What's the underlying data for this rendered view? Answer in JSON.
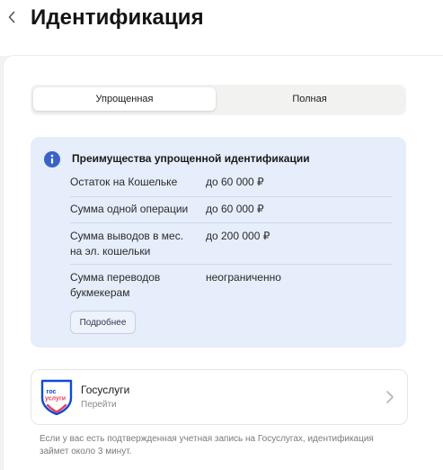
{
  "header": {
    "title": "Идентификация",
    "back_icon": "chevron-left-icon"
  },
  "tabs": [
    {
      "label": "Упрощенная",
      "active": true
    },
    {
      "label": "Полная",
      "active": false
    }
  ],
  "info": {
    "icon": "info-icon",
    "accent_color": "#3a63c6",
    "heading": "Преимущества упрощенной идентификации",
    "rows": [
      {
        "label": "Остаток на Кошельке",
        "value": "до 60 000 ₽"
      },
      {
        "label": "Сумма одной операции",
        "value": "до 60 000 ₽"
      },
      {
        "label": "Сумма выводов в мес. на эл. кошельки",
        "value": "до 200 000 ₽"
      },
      {
        "label": "Сумма переводов букмекерам",
        "value": "неограниченно"
      }
    ],
    "more_button": "Подробнее"
  },
  "gosuslugi": {
    "title": "Госуслуги",
    "subtitle": "Перейти",
    "logo_line1": "гос",
    "logo_line2": "услуги",
    "logo_blue": "#0d4cd3",
    "logo_red": "#ee3f58"
  },
  "note": "Если у вас есть подтвержденная учетная запись на Госуслугах, идентификация займет около 3 минут."
}
